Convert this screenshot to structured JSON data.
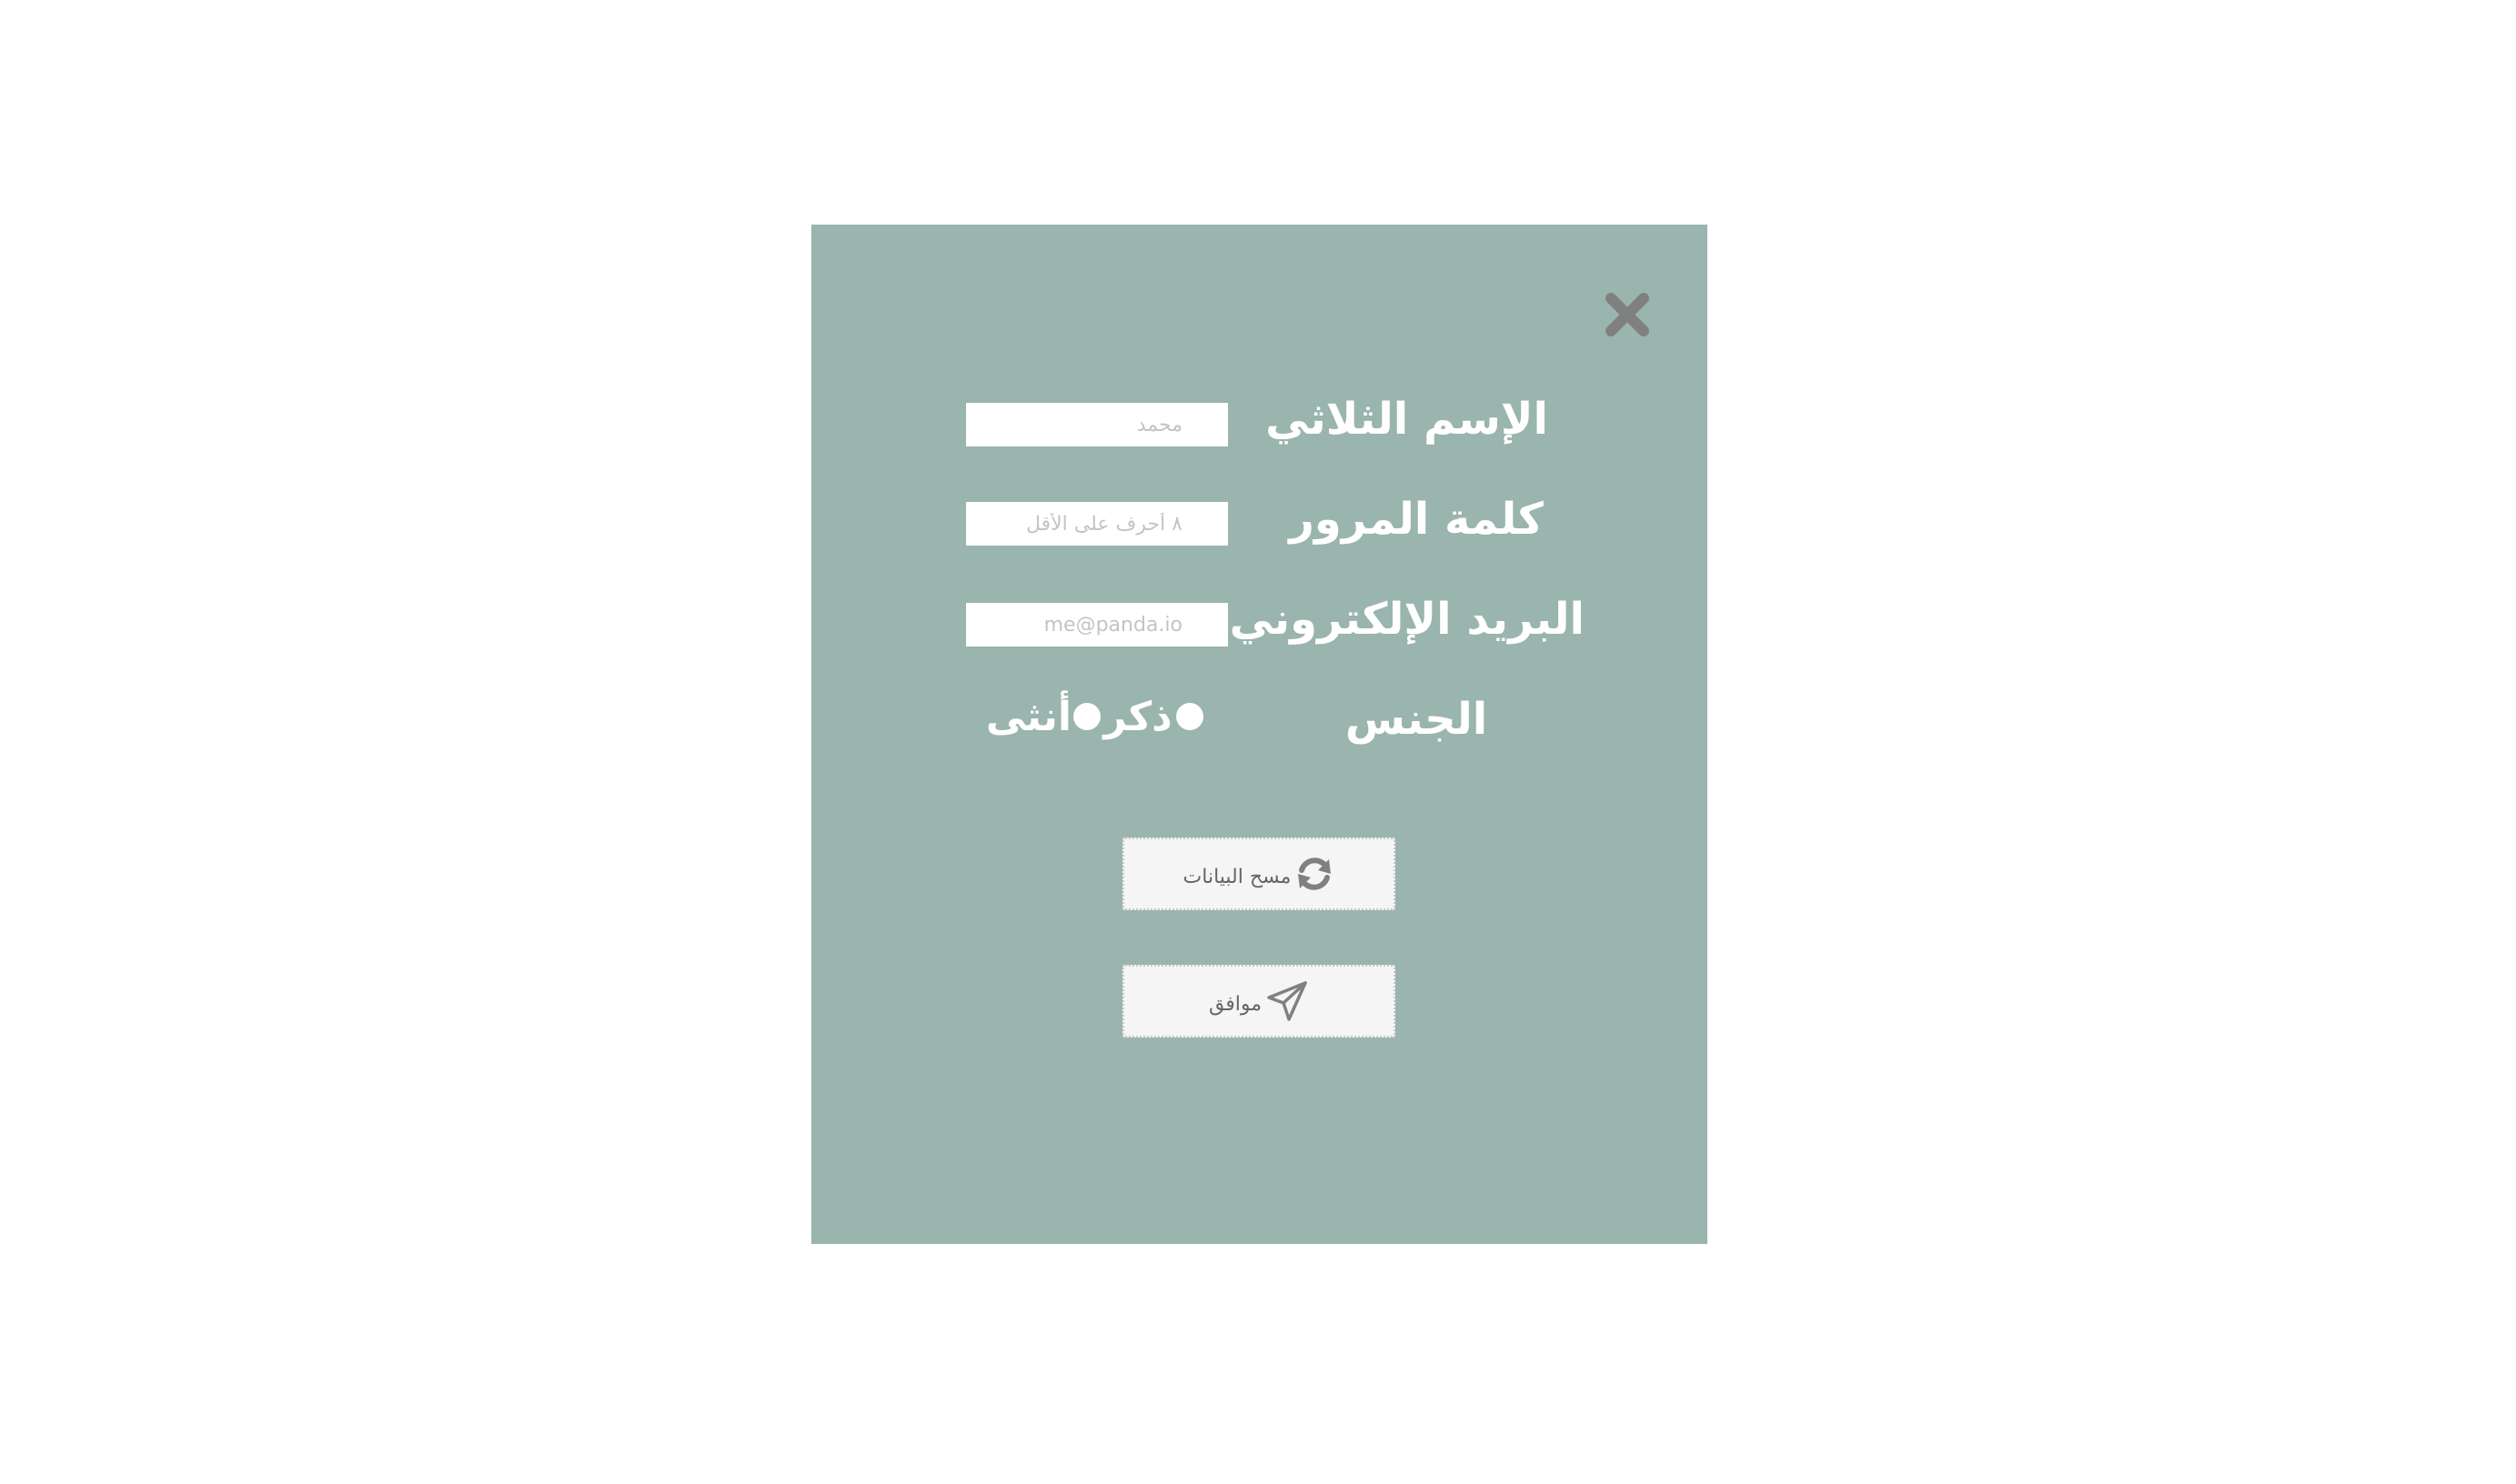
{
  "form": {
    "close_icon": "close-icon",
    "fields": {
      "full_name": {
        "label": "الإسم الثلاثي",
        "placeholder": "محمد",
        "value": ""
      },
      "password": {
        "label": "كلمة المرور",
        "placeholder": "٨ أحرف على الأقل",
        "value": ""
      },
      "email": {
        "label": "البريد الإلكتروني",
        "placeholder": "me@panda.io",
        "value": ""
      }
    },
    "gender": {
      "label": "الجنس",
      "options": [
        "ذكر",
        "أنثى"
      ],
      "selected": ""
    },
    "buttons": {
      "reset": {
        "label": "مسح البيانات",
        "icon": "refresh-icon"
      },
      "submit": {
        "label": "موافق",
        "icon": "paper-plane-icon"
      }
    }
  },
  "colors": {
    "modal_background": "#9ab4ae",
    "page_background": "#ffffff",
    "label_text": "#ffffff",
    "icon": "#808080"
  }
}
